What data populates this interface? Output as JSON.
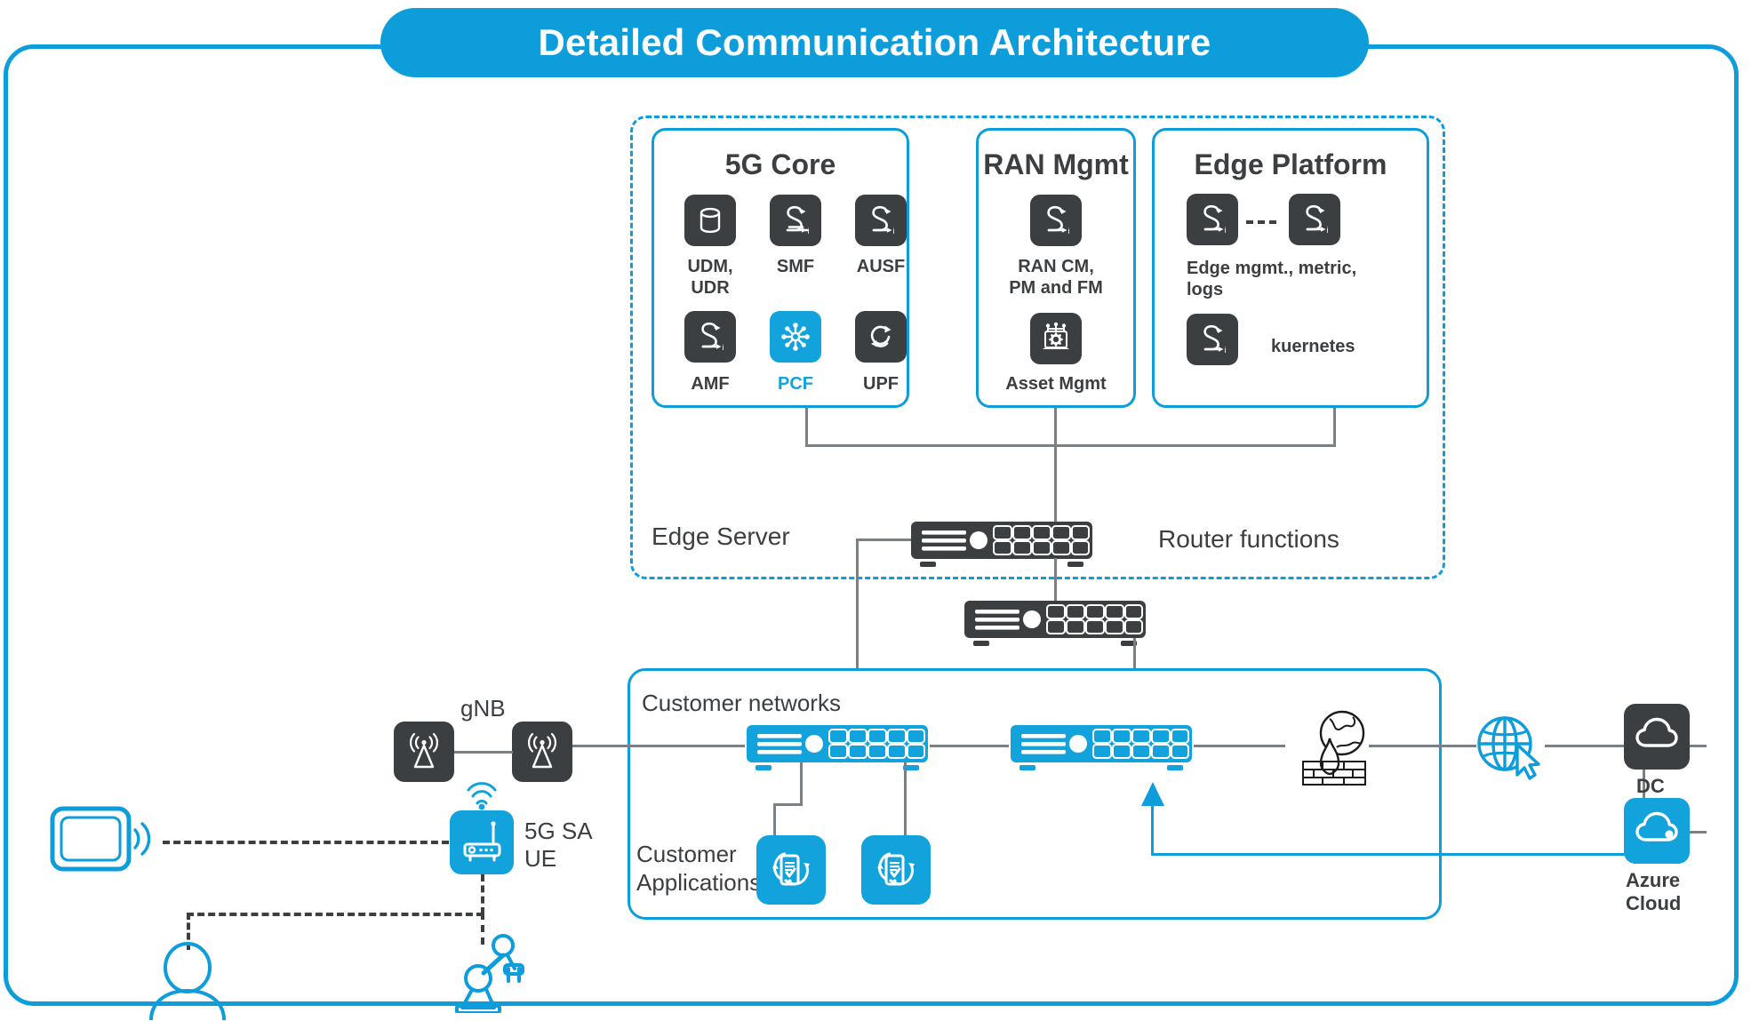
{
  "title": "Detailed Communication Architecture",
  "colors": {
    "accent_blue": "#0d9ddb",
    "icon_blue": "#12a3dd",
    "dark": "#3c3f42",
    "line_gray": "#7b8084",
    "white": "#ffffff"
  },
  "edge_region": {
    "label": "Edge Server",
    "router_label": "Router functions"
  },
  "panels": {
    "core": {
      "title": "5G Core",
      "functions": [
        {
          "label": "UDM,\nUDR",
          "icon": "database-icon",
          "accent": false
        },
        {
          "label": "SMF",
          "icon": "function-i-icon",
          "accent": false
        },
        {
          "label": "AUSF",
          "icon": "function-i-icon",
          "accent": false
        },
        {
          "label": "AMF",
          "icon": "function-i-icon",
          "accent": false
        },
        {
          "label": "PCF",
          "icon": "policy-hub-icon",
          "accent": true
        },
        {
          "label": "UPF",
          "icon": "forwarding-loop-icon",
          "accent": false
        }
      ]
    },
    "ran": {
      "title": "RAN Mgmt",
      "functions": [
        {
          "label": "RAN CM,\nPM and FM",
          "icon": "function-i-icon",
          "accent": false
        },
        {
          "label": "Asset Mgmt",
          "icon": "asset-gear-laptop-icon",
          "accent": false
        }
      ]
    },
    "edge": {
      "title": "Edge Platform",
      "functions": [
        {
          "label": "Edge mgmt., metric,\nlogs",
          "icon": "function-i-icon",
          "accent": false
        },
        {
          "label": "",
          "icon": "function-i-icon",
          "accent": false
        },
        {
          "label": "kuernetes",
          "icon": "function-i-icon",
          "accent": false
        }
      ]
    },
    "customer": {
      "networks_label": "Customer networks",
      "applications_label": "Customer\nApplications"
    }
  },
  "nodes": {
    "gnb_label": "gNB",
    "ue_label": "5G SA\nUE",
    "dc_label": "DC",
    "azure_label": "Azure\nCloud"
  },
  "icons": {
    "tablet": "tablet-wifi-icon",
    "person": "person-icon",
    "robot": "robot-arm-icon",
    "antenna": "antenna-tower-icon",
    "ue_router": "wifi-router-icon",
    "five_g_badge": "5g-signal-badge-icon",
    "firewall": "firewall-globe-icon",
    "internet": "internet-globe-cursor-icon",
    "dc_cloud": "cloud-icon",
    "azure_cloud": "azure-cloud-icon",
    "router": "router-switch-icon",
    "customer_app": "mobile-app-icon"
  }
}
